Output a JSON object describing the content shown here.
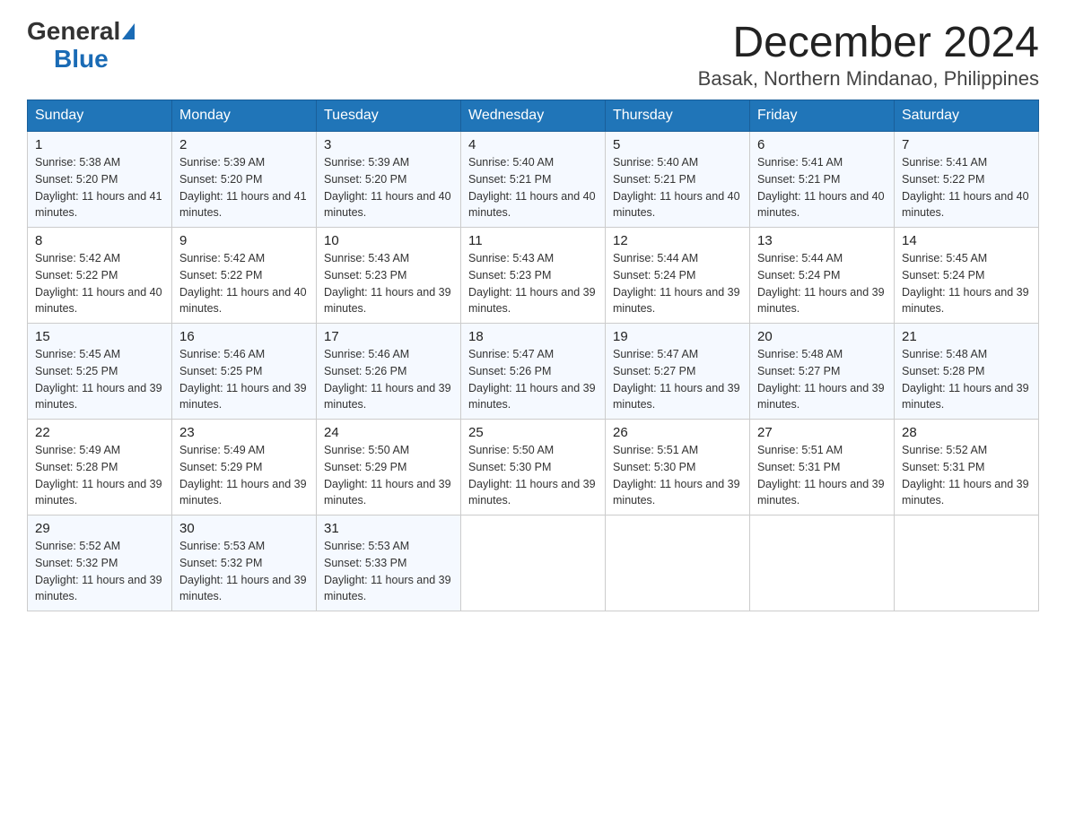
{
  "logo": {
    "general": "General",
    "blue": "Blue",
    "triangle": "▶"
  },
  "title": {
    "month": "December 2024",
    "location": "Basak, Northern Mindanao, Philippines"
  },
  "headers": [
    "Sunday",
    "Monday",
    "Tuesday",
    "Wednesday",
    "Thursday",
    "Friday",
    "Saturday"
  ],
  "weeks": [
    [
      {
        "day": "1",
        "sunrise": "5:38 AM",
        "sunset": "5:20 PM",
        "daylight": "11 hours and 41 minutes."
      },
      {
        "day": "2",
        "sunrise": "5:39 AM",
        "sunset": "5:20 PM",
        "daylight": "11 hours and 41 minutes."
      },
      {
        "day": "3",
        "sunrise": "5:39 AM",
        "sunset": "5:20 PM",
        "daylight": "11 hours and 40 minutes."
      },
      {
        "day": "4",
        "sunrise": "5:40 AM",
        "sunset": "5:21 PM",
        "daylight": "11 hours and 40 minutes."
      },
      {
        "day": "5",
        "sunrise": "5:40 AM",
        "sunset": "5:21 PM",
        "daylight": "11 hours and 40 minutes."
      },
      {
        "day": "6",
        "sunrise": "5:41 AM",
        "sunset": "5:21 PM",
        "daylight": "11 hours and 40 minutes."
      },
      {
        "day": "7",
        "sunrise": "5:41 AM",
        "sunset": "5:22 PM",
        "daylight": "11 hours and 40 minutes."
      }
    ],
    [
      {
        "day": "8",
        "sunrise": "5:42 AM",
        "sunset": "5:22 PM",
        "daylight": "11 hours and 40 minutes."
      },
      {
        "day": "9",
        "sunrise": "5:42 AM",
        "sunset": "5:22 PM",
        "daylight": "11 hours and 40 minutes."
      },
      {
        "day": "10",
        "sunrise": "5:43 AM",
        "sunset": "5:23 PM",
        "daylight": "11 hours and 39 minutes."
      },
      {
        "day": "11",
        "sunrise": "5:43 AM",
        "sunset": "5:23 PM",
        "daylight": "11 hours and 39 minutes."
      },
      {
        "day": "12",
        "sunrise": "5:44 AM",
        "sunset": "5:24 PM",
        "daylight": "11 hours and 39 minutes."
      },
      {
        "day": "13",
        "sunrise": "5:44 AM",
        "sunset": "5:24 PM",
        "daylight": "11 hours and 39 minutes."
      },
      {
        "day": "14",
        "sunrise": "5:45 AM",
        "sunset": "5:24 PM",
        "daylight": "11 hours and 39 minutes."
      }
    ],
    [
      {
        "day": "15",
        "sunrise": "5:45 AM",
        "sunset": "5:25 PM",
        "daylight": "11 hours and 39 minutes."
      },
      {
        "day": "16",
        "sunrise": "5:46 AM",
        "sunset": "5:25 PM",
        "daylight": "11 hours and 39 minutes."
      },
      {
        "day": "17",
        "sunrise": "5:46 AM",
        "sunset": "5:26 PM",
        "daylight": "11 hours and 39 minutes."
      },
      {
        "day": "18",
        "sunrise": "5:47 AM",
        "sunset": "5:26 PM",
        "daylight": "11 hours and 39 minutes."
      },
      {
        "day": "19",
        "sunrise": "5:47 AM",
        "sunset": "5:27 PM",
        "daylight": "11 hours and 39 minutes."
      },
      {
        "day": "20",
        "sunrise": "5:48 AM",
        "sunset": "5:27 PM",
        "daylight": "11 hours and 39 minutes."
      },
      {
        "day": "21",
        "sunrise": "5:48 AM",
        "sunset": "5:28 PM",
        "daylight": "11 hours and 39 minutes."
      }
    ],
    [
      {
        "day": "22",
        "sunrise": "5:49 AM",
        "sunset": "5:28 PM",
        "daylight": "11 hours and 39 minutes."
      },
      {
        "day": "23",
        "sunrise": "5:49 AM",
        "sunset": "5:29 PM",
        "daylight": "11 hours and 39 minutes."
      },
      {
        "day": "24",
        "sunrise": "5:50 AM",
        "sunset": "5:29 PM",
        "daylight": "11 hours and 39 minutes."
      },
      {
        "day": "25",
        "sunrise": "5:50 AM",
        "sunset": "5:30 PM",
        "daylight": "11 hours and 39 minutes."
      },
      {
        "day": "26",
        "sunrise": "5:51 AM",
        "sunset": "5:30 PM",
        "daylight": "11 hours and 39 minutes."
      },
      {
        "day": "27",
        "sunrise": "5:51 AM",
        "sunset": "5:31 PM",
        "daylight": "11 hours and 39 minutes."
      },
      {
        "day": "28",
        "sunrise": "5:52 AM",
        "sunset": "5:31 PM",
        "daylight": "11 hours and 39 minutes."
      }
    ],
    [
      {
        "day": "29",
        "sunrise": "5:52 AM",
        "sunset": "5:32 PM",
        "daylight": "11 hours and 39 minutes."
      },
      {
        "day": "30",
        "sunrise": "5:53 AM",
        "sunset": "5:32 PM",
        "daylight": "11 hours and 39 minutes."
      },
      {
        "day": "31",
        "sunrise": "5:53 AM",
        "sunset": "5:33 PM",
        "daylight": "11 hours and 39 minutes."
      },
      null,
      null,
      null,
      null
    ]
  ],
  "labels": {
    "sunrise": "Sunrise:",
    "sunset": "Sunset:",
    "daylight": "Daylight:"
  }
}
